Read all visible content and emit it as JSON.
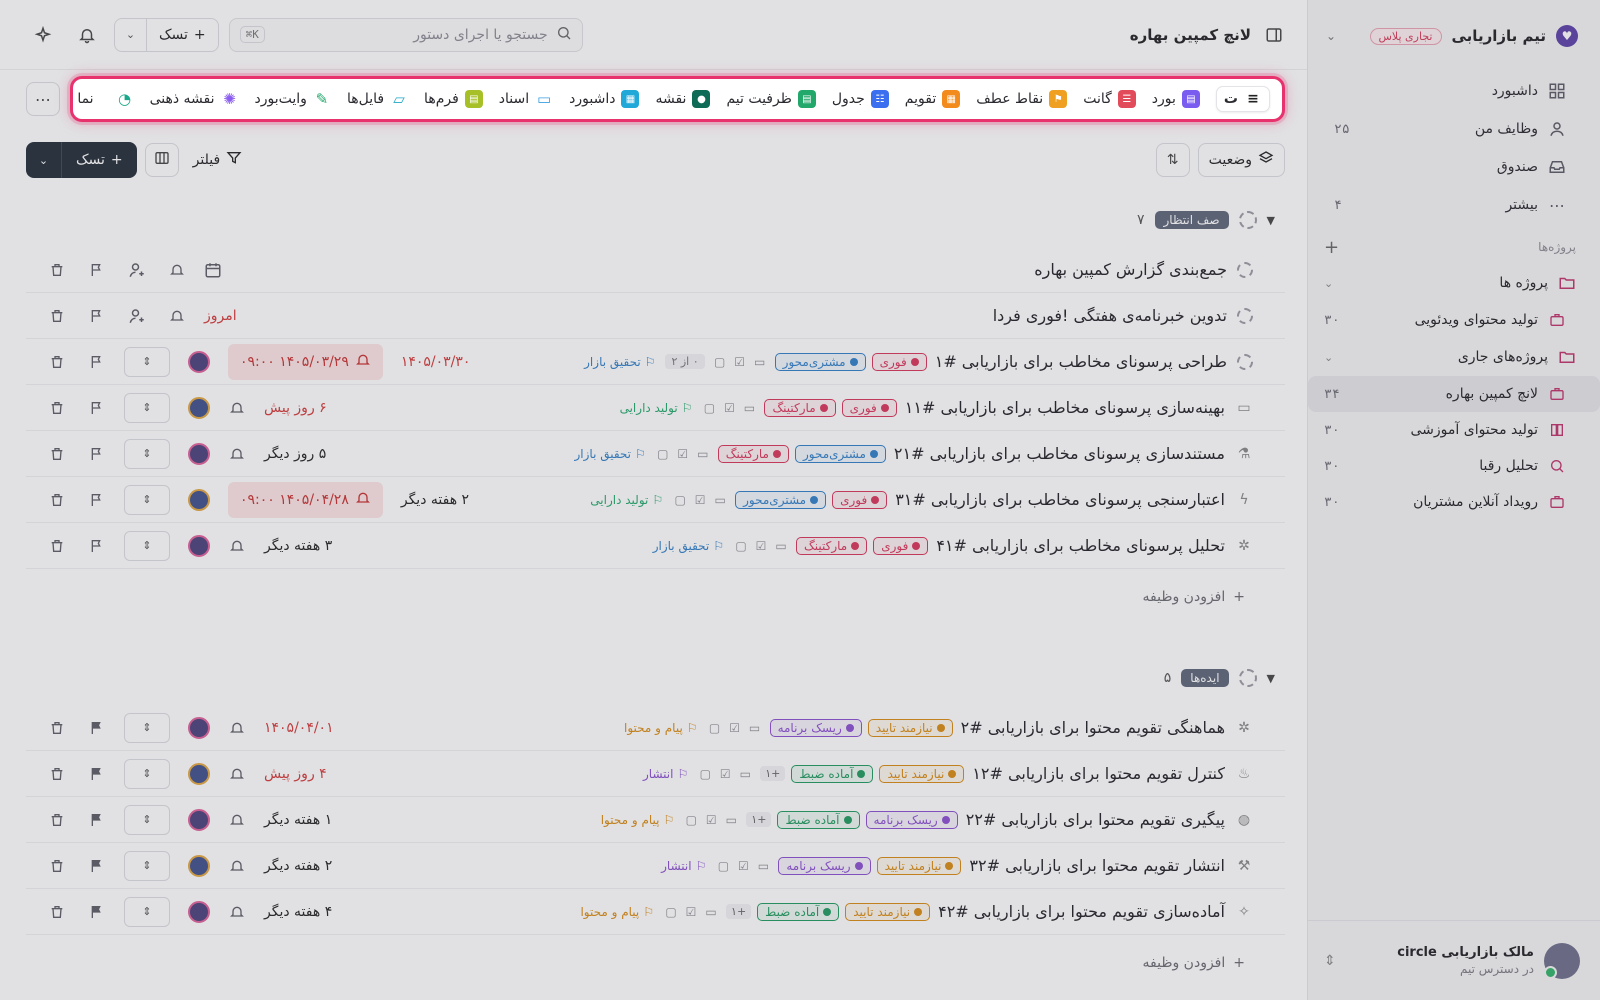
{
  "colors": {
    "accent_highlight": "#e8326e",
    "primary_button": "#222b36",
    "date_overdue": "#d33a3a",
    "group_badge": "#5c6577"
  },
  "workspace": {
    "name": "تیم بازاریابی",
    "plan": "تجاری پلاس"
  },
  "sidebar": {
    "nav": [
      {
        "label": "داشبورد",
        "icon": "dashboard-grid-icon",
        "count": ""
      },
      {
        "label": "وظایف من",
        "icon": "user-icon",
        "count": "۲۵"
      },
      {
        "label": "صندوق",
        "icon": "inbox-icon",
        "count": ""
      },
      {
        "label": "بیشتر",
        "icon": "more-dots-icon",
        "count": "۴"
      }
    ],
    "projects_section": "پروژه‌ها",
    "folder_projects": "پروژه ها",
    "folder_projects_items": [
      {
        "label": "تولید محتوای ویدئویی",
        "icon": "briefcase-icon",
        "count": "۳۰"
      }
    ],
    "folder_current": "پروژه‌های جاری",
    "folder_current_items": [
      {
        "label": "لانچ کمپین بهاره",
        "icon": "briefcase-icon",
        "count": "۳۴"
      },
      {
        "label": "تولید محتوای آموزشی",
        "icon": "book-icon",
        "count": "۳۰"
      },
      {
        "label": "تحلیل رقبا",
        "icon": "search-icon",
        "count": "۳۰"
      },
      {
        "label": "رویداد آنلاین مشتریان",
        "icon": "briefcase-icon",
        "count": "۳۰"
      }
    ]
  },
  "user": {
    "name": "مالک بازاریابی circle",
    "subtitle": "در دسترس تیم"
  },
  "topbar": {
    "title": "لانچ کمپین بهاره",
    "search_placeholder": "جستجو یا اجرای دستور",
    "shortcut": "⌘K",
    "task_button": "تسک"
  },
  "views": [
    {
      "label": "ت",
      "icon": "list-icon",
      "color": "#ffffff",
      "active": true
    },
    {
      "label": "بورد",
      "icon": "board-icon",
      "color": "#7b5cf0"
    },
    {
      "label": "گانت",
      "icon": "gantt-icon",
      "color": "#e24b5a"
    },
    {
      "label": "نقاط عطف",
      "icon": "milestone-flag-icon",
      "color": "#f0a020"
    },
    {
      "label": "تقویم",
      "icon": "calendar-icon",
      "color": "#f28a1c"
    },
    {
      "label": "جدول",
      "icon": "table-icon",
      "color": "#3c6ff0"
    },
    {
      "label": "ظرفیت تیم",
      "icon": "capacity-icon",
      "color": "#22a86b"
    },
    {
      "label": "نقشه",
      "icon": "map-pin-icon",
      "color": "#0f6b55"
    },
    {
      "label": "داشبورد",
      "icon": "dashboard-icon",
      "color": "#20a8d8"
    },
    {
      "label": "اسناد",
      "icon": "doc-icon",
      "color": "#3aa0e0"
    },
    {
      "label": "فرم‌ها",
      "icon": "form-icon",
      "color": "#a7c028"
    },
    {
      "label": "فایل‌ها",
      "icon": "folder-icon",
      "color": "#20a8c8"
    },
    {
      "label": "وایت‌بورد",
      "icon": "pen-icon",
      "color": "#22a86b"
    },
    {
      "label": "نقشه ذهنی",
      "icon": "mindmap-icon",
      "color": "#8a5cf0"
    },
    {
      "label": "",
      "icon": "gauge-icon",
      "color": "#1aa88a"
    },
    {
      "label": "نما",
      "icon": "plus-icon",
      "color": "#666666"
    }
  ],
  "toolbar": {
    "status_button": "وضعیت",
    "filter_button": "فیلتر",
    "task_button": "تسک"
  },
  "groups": [
    {
      "name": "صف انتظار",
      "count": "۷",
      "add_label": "افزودن وظیفه",
      "tasks": [
        {
          "title": "جمع‌بندی گزارش کمپین بهاره",
          "status": "dash",
          "tags": [],
          "project": "",
          "project_color": "",
          "subtask": "",
          "plus": "",
          "due": "",
          "due_style": "",
          "alarm": "",
          "avatar": false,
          "calendar": true
        },
        {
          "title": "تدوین خبرنامه‌ی هفتگی !فوری فردا",
          "status": "dash",
          "tags": [],
          "project": "",
          "project_color": "",
          "subtask": "",
          "plus": "",
          "due": "امروز",
          "due_style": "red",
          "alarm": "",
          "avatar": false
        },
        {
          "title": "طراحی پرسونای مخاطب برای بازاریابی #۱",
          "status": "dash",
          "tags": [
            {
              "label": "فوری",
              "color": "#d8345a"
            },
            {
              "label": "مشتری‌محور",
              "color": "#2f7fc8"
            }
          ],
          "project": "تحقیق بازار",
          "project_color": "#2f7fc8",
          "subtask": "۰ از ۲",
          "plus": "",
          "due": "۱۴۰۵/۰۳/۳۰",
          "due_style": "red",
          "alarm": "۱۴۰۵/۰۳/۲۹ ۰۹:۰۰",
          "avatar": true
        },
        {
          "title": "بهینه‌سازی پرسونای مخاطب برای بازاریابی #۱۱",
          "status": "doc",
          "tags": [
            {
              "label": "فوری",
              "color": "#d8345a"
            },
            {
              "label": "مارکتینگ",
              "color": "#d8345a"
            }
          ],
          "project": "تولید دارایی",
          "project_color": "#22a86b",
          "subtask": "",
          "plus": "",
          "due": "۶ روز پیش",
          "due_style": "red",
          "alarm": "",
          "avatar": true
        },
        {
          "title": "مستندسازی پرسونای مخاطب برای بازاریابی #۲۱",
          "status": "flask",
          "tags": [
            {
              "label": "مشتری‌محور",
              "color": "#2f7fc8"
            },
            {
              "label": "مارکتینگ",
              "color": "#d8345a"
            }
          ],
          "project": "تحقیق بازار",
          "project_color": "#2f7fc8",
          "subtask": "",
          "plus": "",
          "due": "۵ روز دیگر",
          "due_style": "dark",
          "alarm": "",
          "avatar": true
        },
        {
          "title": "اعتبارسنجی پرسونای مخاطب برای بازاریابی #۳۱",
          "status": "bolt",
          "tags": [
            {
              "label": "فوری",
              "color": "#d8345a"
            },
            {
              "label": "مشتری‌محور",
              "color": "#2f7fc8"
            }
          ],
          "project": "تولید دارایی",
          "project_color": "#22a86b",
          "subtask": "",
          "plus": "",
          "due": "۲ هفته دیگر",
          "due_style": "dark",
          "alarm": "۱۴۰۵/۰۴/۲۸ ۰۹:۰۰",
          "avatar": true
        },
        {
          "title": "تحلیل پرسونای مخاطب برای بازاریابی #۴۱",
          "status": "bug",
          "tags": [
            {
              "label": "فوری",
              "color": "#d8345a"
            },
            {
              "label": "مارکتینگ",
              "color": "#d8345a"
            }
          ],
          "project": "تحقیق بازار",
          "project_color": "#2f7fc8",
          "subtask": "",
          "plus": "",
          "due": "۳ هفته دیگر",
          "due_style": "dark",
          "alarm": "",
          "avatar": true
        }
      ]
    },
    {
      "name": "ایده‌ها",
      "count": "۵",
      "add_label": "افزودن وظیفه",
      "tasks": [
        {
          "title": "هماهنگی تقویم محتوا برای بازاریابی #۲",
          "status": "bug",
          "tags": [
            {
              "label": "نیازمند تایید",
              "color": "#d88a10"
            },
            {
              "label": "ریسک برنامه",
              "color": "#8a4fd0"
            }
          ],
          "project": "پیام و محتوا",
          "project_color": "#d88a10",
          "subtask": "",
          "plus": "",
          "due": "۱۴۰۵/۰۴/۰۱",
          "due_style": "red",
          "alarm": "",
          "avatar": true
        },
        {
          "title": "کنترل تقویم محتوا برای بازاریابی #۱۲",
          "status": "fire",
          "tags": [
            {
              "label": "نیازمند تایید",
              "color": "#d88a10"
            },
            {
              "label": "آماده ضبط",
              "color": "#1f9a5e"
            }
          ],
          "project": "انتشار",
          "project_color": "#8a4fd0",
          "subtask": "",
          "plus": "+۱",
          "due": "۴ روز پیش",
          "due_style": "red",
          "alarm": "",
          "avatar": true
        },
        {
          "title": "پیگیری تقویم محتوا برای بازاریابی #۲۲",
          "status": "palette",
          "tags": [
            {
              "label": "ریسک برنامه",
              "color": "#8a4fd0"
            },
            {
              "label": "آماده ضبط",
              "color": "#1f9a5e"
            }
          ],
          "project": "پیام و محتوا",
          "project_color": "#d88a10",
          "subtask": "",
          "plus": "+۱",
          "due": "۱ هفته دیگر",
          "due_style": "dark",
          "alarm": "",
          "avatar": true
        },
        {
          "title": "انتشار تقویم محتوا برای بازاریابی #۳۲",
          "status": "hammer",
          "tags": [
            {
              "label": "نیازمند تایید",
              "color": "#d88a10"
            },
            {
              "label": "ریسک برنامه",
              "color": "#8a4fd0"
            }
          ],
          "project": "انتشار",
          "project_color": "#8a4fd0",
          "subtask": "",
          "plus": "",
          "due": "۲ هفته دیگر",
          "due_style": "dark",
          "alarm": "",
          "avatar": true
        },
        {
          "title": "آماده‌سازی تقویم محتوا برای بازاریابی #۴۲",
          "status": "sparkle",
          "tags": [
            {
              "label": "نیازمند تایید",
              "color": "#d88a10"
            },
            {
              "label": "آماده ضبط",
              "color": "#1f9a5e"
            }
          ],
          "project": "پیام و محتوا",
          "project_color": "#d88a10",
          "subtask": "",
          "plus": "+۱",
          "due": "۴ هفته دیگر",
          "due_style": "dark",
          "alarm": "",
          "avatar": true
        }
      ]
    }
  ]
}
